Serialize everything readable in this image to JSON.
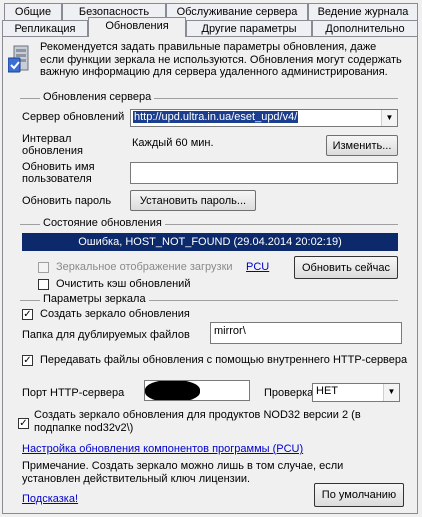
{
  "tabs_row1": [
    {
      "label": "Общие"
    },
    {
      "label": "Безопасность"
    },
    {
      "label": "Обслуживание сервера"
    },
    {
      "label": "Ведение журнала"
    }
  ],
  "tabs_row2": [
    {
      "label": "Репликация"
    },
    {
      "label": "Обновления"
    },
    {
      "label": "Другие параметры"
    },
    {
      "label": "Дополнительно"
    }
  ],
  "info_text": "Рекомендуется задать правильные параметры обновления, даже если функции зеркала не используются. Обновления могут содержать важную информацию для сервера удаленного администрирования.",
  "update_server": {
    "group_label": "Обновления сервера",
    "server_label": "Сервер обновлений",
    "server_value": "http://upd.ultra.in.ua/eset_upd/v4/",
    "interval_label": "Интервал обновления",
    "interval_value": "Каждый 60 мин.",
    "change_button": "Изменить...",
    "username_label": "Обновить имя пользователя",
    "username_value": "",
    "password_label": "Обновить пароль",
    "set_password_button": "Установить пароль..."
  },
  "update_status": {
    "group_label": "Состояние обновления",
    "status_text": "Ошибка, HOST_NOT_FOUND (29.04.2014 20:02:19)",
    "status_color": "#0c2a6b",
    "mirror_download_label": "Зеркальное отображение загрузки",
    "mirror_download_checked": false,
    "pcu_link": "PCU",
    "update_now_button": "Обновить сейчас",
    "clear_cache_label": "Очистить кэш обновлений",
    "clear_cache_checked": false
  },
  "mirror": {
    "group_label": "Параметры зеркала",
    "create_mirror_label": "Создать зеркало обновления",
    "create_mirror_checked": true,
    "folder_label": "Папка для дублируемых файлов",
    "folder_value": "mirror\\",
    "http_label": "Передавать файлы обновления с помощью внутреннего HTTP-сервера",
    "http_checked": true,
    "port_label": "Порт HTTP-сервера",
    "port_value": "",
    "check_label": "Проверка",
    "check_value": "НЕТ",
    "nod32_label": "Создать зеркало обновления для продуктов NOD32 версии 2 (в подпапке nod32v2\\)",
    "nod32_checked": true
  },
  "pcu_settings_link": "Настройка обновления компонентов программы (PCU)",
  "note_text": "Примечание. Создать зеркало можно лишь в том случае, если установлен действительный ключ лицензии.",
  "hint_link": "Подсказка!",
  "default_button": "По умолчанию"
}
